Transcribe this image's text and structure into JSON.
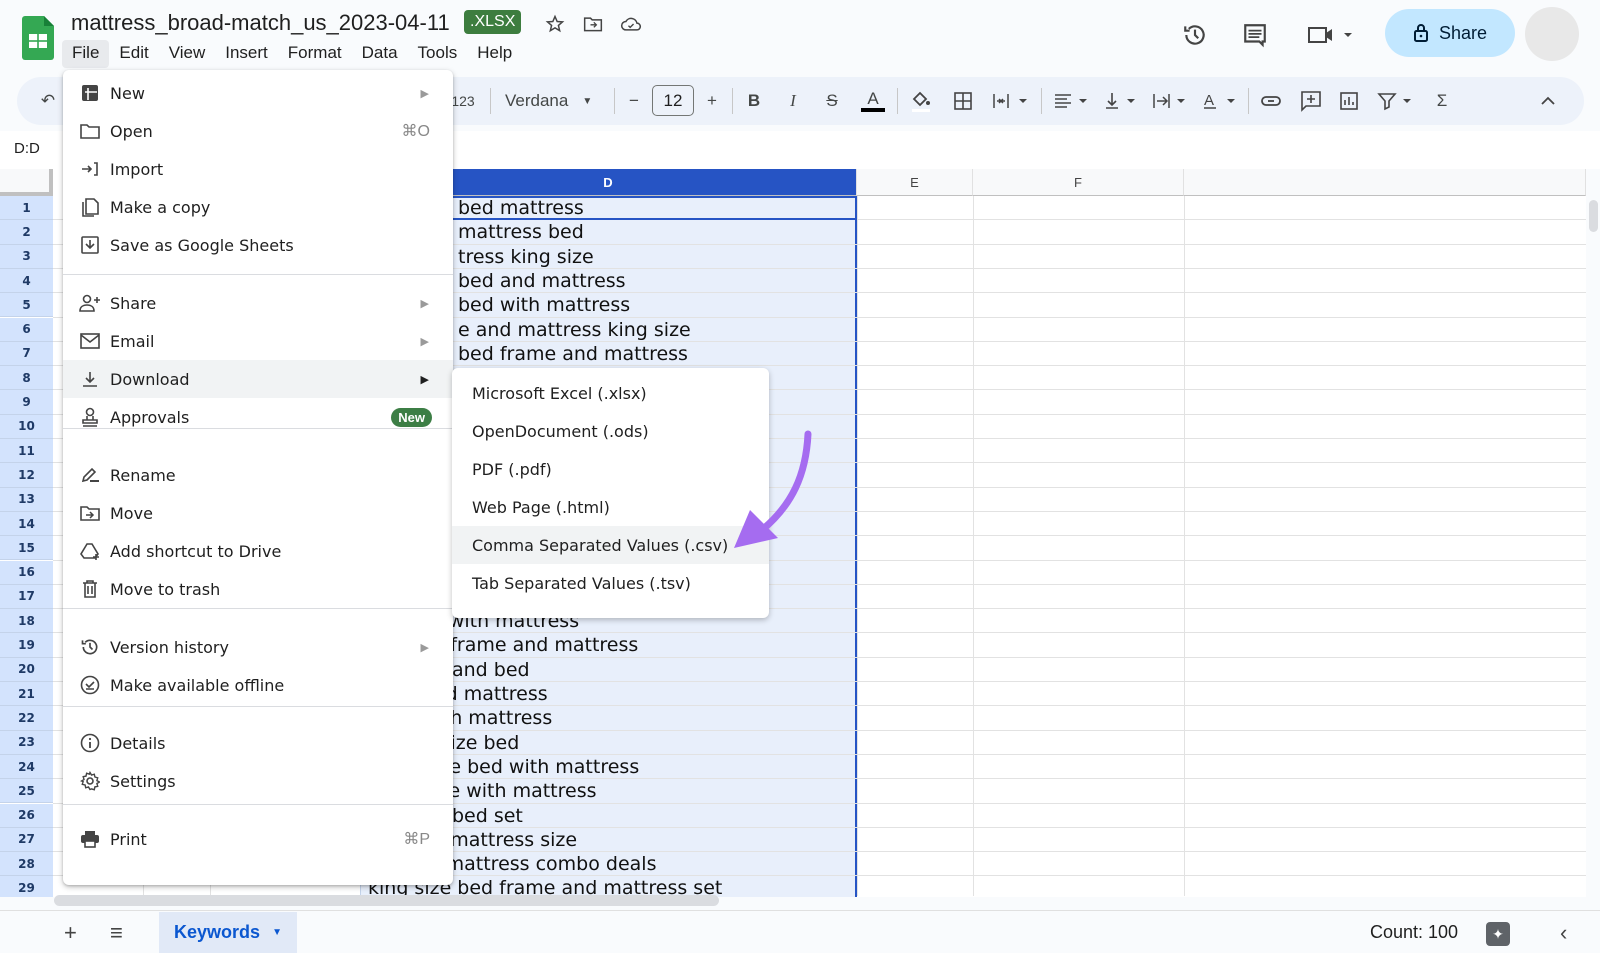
{
  "app": {
    "title": "mattress_broad-match_us_2023-04-11",
    "file_badge": ".XLSX",
    "share_label": "Share"
  },
  "menubar": [
    "File",
    "Edit",
    "View",
    "Insert",
    "Format",
    "Data",
    "Tools",
    "Help"
  ],
  "toolbar": {
    "number_format": "123",
    "font": "Verdana",
    "font_size": "12"
  },
  "formula": {
    "name_box": "D:D"
  },
  "columns": {
    "d": "D",
    "e": "E",
    "f": "F"
  },
  "rows": [
    "1",
    "2",
    "3",
    "4",
    "5",
    "6",
    "7",
    "8",
    "9",
    "10",
    "11",
    "12",
    "13",
    "14",
    "15",
    "16",
    "17",
    "18",
    "19",
    "20",
    "21",
    "22",
    "23",
    "24",
    "25",
    "26",
    "27",
    "28",
    "29"
  ],
  "cells_d": [
    {
      "row": 1,
      "text": "bed mattress"
    },
    {
      "row": 2,
      "text": "mattress bed"
    },
    {
      "row": 3,
      "text": "tress king size"
    },
    {
      "row": 4,
      "text": "bed and mattress"
    },
    {
      "row": 5,
      "text": "bed with mattress"
    },
    {
      "row": 6,
      "text": "e and mattress king size"
    },
    {
      "row": 7,
      "text": "bed frame and mattress"
    },
    {
      "row": 18,
      "text": "bed sets with mattress"
    },
    {
      "row": 19,
      "text": "bed with frame and mattress"
    },
    {
      "row": 20,
      "text": "mattress and bed"
    },
    {
      "row": 21,
      "text": "d bed and mattress"
    },
    {
      "row": 22,
      "text": "d bed with mattress"
    },
    {
      "row": 23,
      "text": "for king size bed"
    },
    {
      "row": 24,
      "text": "adjustable bed with mattress"
    },
    {
      "row": 25,
      "text": "bed frame with mattress"
    },
    {
      "row": 26,
      "text": "mattress bed set"
    },
    {
      "row": 27,
      "text": "king bed mattress size"
    },
    {
      "row": 28,
      "text": "bed and mattress combo deals"
    },
    {
      "row": 29,
      "text": "king size bed frame and mattress set"
    }
  ],
  "file_menu": {
    "items": [
      {
        "label": "New",
        "icon": "new-sheet-icon",
        "arrow": true
      },
      {
        "label": "Open",
        "icon": "folder-icon",
        "shortcut": "⌘O"
      },
      {
        "label": "Import",
        "icon": "import-icon"
      },
      {
        "label": "Make a copy",
        "icon": "copy-icon"
      },
      {
        "label": "Save as Google Sheets",
        "icon": "save-icon"
      },
      {
        "label": "Share",
        "icon": "person-add-icon",
        "arrow": true
      },
      {
        "label": "Email",
        "icon": "mail-icon",
        "arrow": true
      },
      {
        "label": "Download",
        "icon": "download-icon",
        "arrow": true,
        "hover": true
      },
      {
        "label": "Approvals",
        "icon": "approvals-icon",
        "badge": "New"
      },
      {
        "label": "Rename",
        "icon": "rename-icon"
      },
      {
        "label": "Move",
        "icon": "move-icon"
      },
      {
        "label": "Add shortcut to Drive",
        "icon": "drive-shortcut-icon"
      },
      {
        "label": "Move to trash",
        "icon": "trash-icon"
      },
      {
        "label": "Version history",
        "icon": "history-icon",
        "arrow": true
      },
      {
        "label": "Make available offline",
        "icon": "offline-icon"
      },
      {
        "label": "Details",
        "icon": "info-icon"
      },
      {
        "label": "Settings",
        "icon": "settings-icon"
      },
      {
        "label": "Print",
        "icon": "print-icon",
        "shortcut": "⌘P"
      }
    ]
  },
  "download_menu": {
    "items": [
      {
        "label": "Microsoft Excel (.xlsx)"
      },
      {
        "label": "OpenDocument (.ods)"
      },
      {
        "label": "PDF (.pdf)"
      },
      {
        "label": "Web Page (.html)"
      },
      {
        "label": "Comma Separated Values (.csv)",
        "hover": true
      },
      {
        "label": "Tab Separated Values (.tsv)"
      }
    ]
  },
  "annotation": {
    "arrow_color": "#a56cf0"
  },
  "bottom": {
    "sheet_tab": "Keywords",
    "count": "Count: 100"
  },
  "colors": {
    "selection": "#2654c4",
    "share_bg": "#c2e7ff",
    "badge_green": "#3c7e45"
  }
}
